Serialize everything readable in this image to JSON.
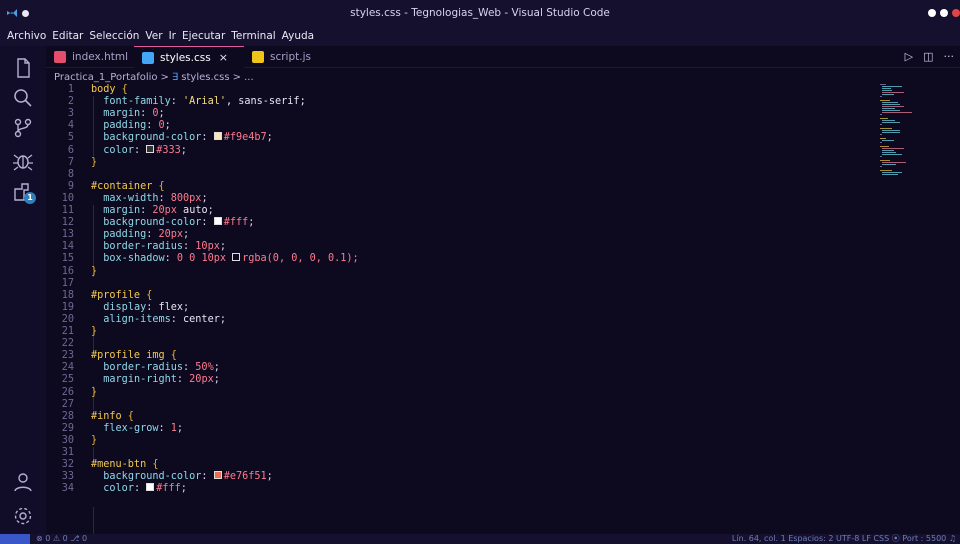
{
  "window": {
    "title": "styles.css - Tegnologias_Web - Visual Studio Code"
  },
  "menu": [
    "Archivo",
    "Editar",
    "Selección",
    "Ver",
    "Ir",
    "Ejecutar",
    "Terminal",
    "Ayuda"
  ],
  "tabs": [
    {
      "label": "index.html",
      "icon": "html-file-icon",
      "color": "#e44d6c"
    },
    {
      "label": "styles.css",
      "icon": "css-file-icon",
      "color": "#42a5f5",
      "close": "×"
    },
    {
      "label": "script.js",
      "icon": "js-file-icon",
      "color": "#f0c419"
    }
  ],
  "breadcrumb": {
    "folder": "Practica_1_Portafolio",
    "sep1": ">",
    "file": "styles.css",
    "sep2": "> ..."
  },
  "activity_badge": "1",
  "code_lines": [
    {
      "n": "1"
    },
    {
      "n": "2"
    },
    {
      "n": "3"
    },
    {
      "n": "4"
    },
    {
      "n": "5"
    },
    {
      "n": "6"
    },
    {
      "n": "7"
    },
    {
      "n": "8"
    },
    {
      "n": "9"
    },
    {
      "n": "10"
    },
    {
      "n": "11"
    },
    {
      "n": "12"
    },
    {
      "n": "13"
    },
    {
      "n": "14"
    },
    {
      "n": "15"
    },
    {
      "n": "16"
    },
    {
      "n": "17"
    },
    {
      "n": "18"
    },
    {
      "n": "19"
    },
    {
      "n": "20"
    },
    {
      "n": "21"
    },
    {
      "n": "22"
    },
    {
      "n": "23"
    },
    {
      "n": "24"
    },
    {
      "n": "25"
    },
    {
      "n": "26"
    },
    {
      "n": "27"
    },
    {
      "n": "28"
    },
    {
      "n": "29"
    },
    {
      "n": "30"
    },
    {
      "n": "31"
    },
    {
      "n": "32"
    },
    {
      "n": "33"
    },
    {
      "n": "34"
    }
  ],
  "code": {
    "l1_sel": "body",
    "l1_brace": " {",
    "l2_prop": "font-family",
    "l2_val_str": "'Arial'",
    "l2_val_rest": ", sans-serif;",
    "l3_prop": "margin",
    "l3_val": "0",
    "l4_prop": "padding",
    "l4_val": "0",
    "l5_prop": "background-color",
    "l5_val": "#f9e4b7",
    "l6_prop": "color",
    "l6_val": "#333",
    "l9_sel": "#container",
    "l10_prop": "max-width",
    "l10_val": "800px",
    "l11_prop": "margin",
    "l11_val": "20px",
    "l11_val2": " auto",
    "l12_prop": "background-color",
    "l12_val": "#fff",
    "l13_prop": "padding",
    "l13_val": "20px",
    "l14_prop": "border-radius",
    "l14_val": "10px",
    "l15_prop": "box-shadow",
    "l15_val": "0 0 10px",
    "l15_fn": "rgba",
    "l15_args": "(0, 0, 0, 0.1);",
    "l18_sel": "#profile",
    "l19_prop": "display",
    "l19_val": "flex",
    "l20_prop": "align-items",
    "l20_val": "center",
    "l23_sel": "#profile img",
    "l24_prop": "border-radius",
    "l24_val": "50%",
    "l25_prop": "margin-right",
    "l25_val": "20px",
    "l28_sel": "#info",
    "l29_prop": "flex-grow",
    "l29_val": "1",
    "l32_sel": "#menu-btn",
    "l33_prop": "background-color",
    "l33_val": "#e76f51",
    "l34_prop": "color",
    "l34_val": "#fff",
    "close_brace": "}"
  },
  "status": {
    "left": "⊗ 0 ⚠ 0   ⎇ 0",
    "right": "Lín. 64, col. 1   Espacios: 2   UTF-8   LF   CSS   ⦿ Port : 5500   ♫"
  },
  "colors": {
    "accent_pink": "#e05a9c",
    "editor_bg": "#0d0a1f",
    "swatch_bg": "#f9e4b7",
    "swatch_333": "#333333",
    "swatch_fff": "#ffffff",
    "swatch_e76f51": "#e76f51"
  }
}
